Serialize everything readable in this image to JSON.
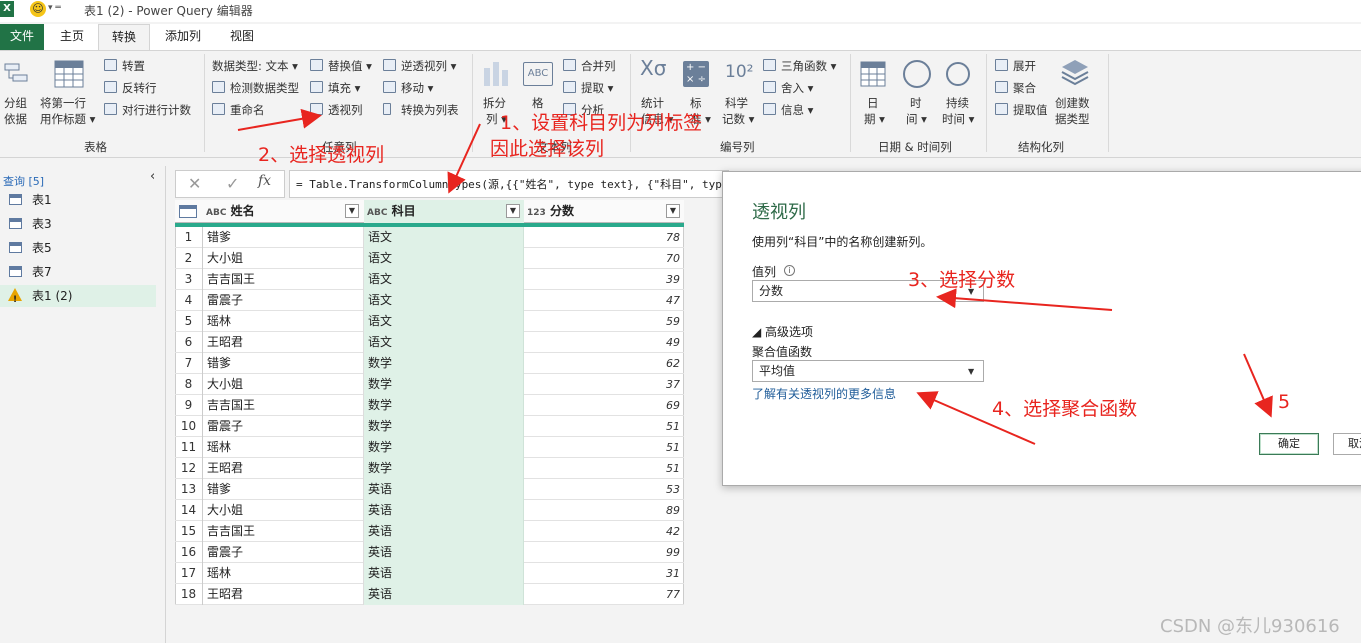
{
  "window": {
    "title": "表1 (2) - Power Query 编辑器"
  },
  "tabs": [
    "文件",
    "主页",
    "转换",
    "添加列",
    "视图"
  ],
  "ribbon": {
    "table_group": {
      "group_by": [
        "分组",
        "依据"
      ],
      "first_row": [
        "将第一行",
        "用作标题 ▾"
      ],
      "transpose": "转置",
      "reverse_rows": "反转行",
      "count_rows": "对行进行计数",
      "label": "表格"
    },
    "any_column": {
      "data_type": "数据类型: 文本 ▾",
      "detect_type": "检测数据类型",
      "rename": "重命名",
      "replace_values": "替换值 ▾",
      "fill": "填充 ▾",
      "pivot": "透视列",
      "unpivot": "逆透视列 ▾",
      "move": "移动 ▾",
      "to_list": "转换为列表",
      "label": "任意列"
    },
    "text_column": {
      "split": [
        "拆分",
        "列 ▾"
      ],
      "format": "格",
      "merge": "合并列",
      "extract": "提取 ▾",
      "parse": "分析",
      "label": "文本列"
    },
    "number_column": {
      "stats": [
        "统计",
        "信息 ▾"
      ],
      "standard": [
        "标",
        "准 ▾"
      ],
      "scientific": [
        "科学",
        "记数 ▾"
      ],
      "trig": "三角函数 ▾",
      "round": "舍入 ▾",
      "info": "信息 ▾",
      "label": "编号列"
    },
    "datetime": {
      "date": [
        "日",
        "期 ▾"
      ],
      "time": [
        "时",
        "间 ▾"
      ],
      "duration": [
        "持续",
        "时间 ▾"
      ],
      "label": "日期 & 时间列"
    },
    "structured": {
      "expand": "展开",
      "aggregate": "聚合",
      "extract_values": "提取值",
      "create_type": [
        "创建数",
        "据类型"
      ],
      "label": "结构化列"
    }
  },
  "queries": {
    "header": "查询 [5]",
    "items": [
      "表1",
      "表3",
      "表5",
      "表7",
      "表1 (2)"
    ]
  },
  "formula": {
    "text": "= Table.TransformColumnTypes(源,{{\"姓名\", type text}, {\"科目\", type text}, {\"分数\", Int64.Type}})"
  },
  "grid": {
    "columns": [
      {
        "type": "ABC",
        "name": "姓名"
      },
      {
        "type": "ABC",
        "name": "科目"
      },
      {
        "type": "123",
        "name": "分数"
      }
    ],
    "rows": [
      [
        "1",
        "错爹",
        "语文",
        "78"
      ],
      [
        "2",
        "大小姐",
        "语文",
        "70"
      ],
      [
        "3",
        "吉吉国王",
        "语文",
        "39"
      ],
      [
        "4",
        "雷震子",
        "语文",
        "47"
      ],
      [
        "5",
        "瑶林",
        "语文",
        "59"
      ],
      [
        "6",
        "王昭君",
        "语文",
        "49"
      ],
      [
        "7",
        "错爹",
        "数学",
        "62"
      ],
      [
        "8",
        "大小姐",
        "数学",
        "37"
      ],
      [
        "9",
        "吉吉国王",
        "数学",
        "69"
      ],
      [
        "10",
        "雷震子",
        "数学",
        "51"
      ],
      [
        "11",
        "瑶林",
        "数学",
        "51"
      ],
      [
        "12",
        "王昭君",
        "数学",
        "51"
      ],
      [
        "13",
        "错爹",
        "英语",
        "53"
      ],
      [
        "14",
        "大小姐",
        "英语",
        "89"
      ],
      [
        "15",
        "吉吉国王",
        "英语",
        "42"
      ],
      [
        "16",
        "雷震子",
        "英语",
        "99"
      ],
      [
        "17",
        "瑶林",
        "英语",
        "31"
      ],
      [
        "18",
        "王昭君",
        "英语",
        "77"
      ]
    ]
  },
  "dialog": {
    "title": "透视列",
    "description": "使用列“科目”中的名称创建新列。",
    "values_label": "值列",
    "values_selected": "分数",
    "advanced": "◢ 高级选项",
    "agg_label": "聚合值函数",
    "agg_selected": "平均值",
    "learn_more": "了解有关透视列的更多信息",
    "ok": "确定",
    "cancel": "取消"
  },
  "annotations": {
    "a1": "1、设置科目列为列标签",
    "a1b": "因此选择该列",
    "a2": "2、选择透视列",
    "a3": "3、选择分数",
    "a4": "4、选择聚合函数",
    "a5": "5"
  },
  "watermark": "CSDN @东儿930616",
  "colors": {
    "accent": "#217346",
    "selection": "#dff1e7",
    "annotation": "#e8251f",
    "dialog_title": "#2e6a48"
  }
}
